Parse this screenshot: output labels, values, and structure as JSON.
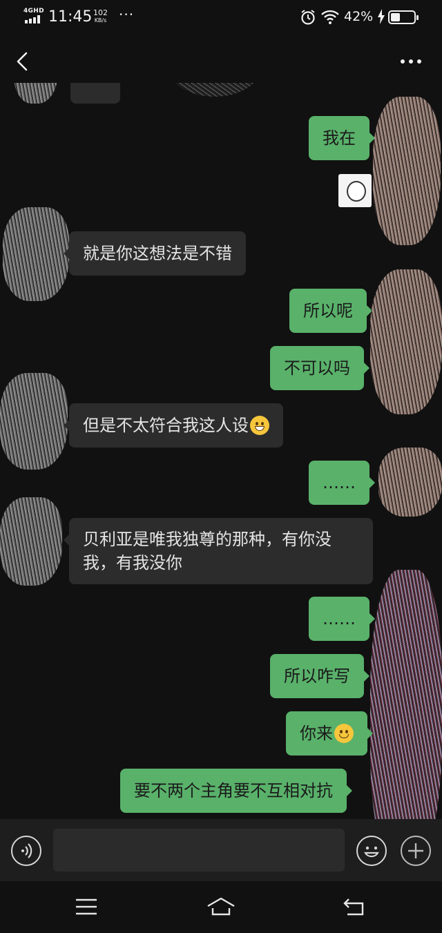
{
  "status_bar": {
    "network": "4GHD",
    "time": "11:45",
    "speed_value": "102",
    "speed_unit": "KB/s",
    "more": "···",
    "battery_percent": "42%",
    "battery_level": 0.42
  },
  "header": {
    "back_icon": "chevron-left-icon",
    "more_icon": "more-horizontal-icon"
  },
  "messages": [
    {
      "side": "out",
      "text": "我在"
    },
    {
      "side": "out",
      "type": "sticker"
    },
    {
      "side": "in",
      "text": "就是你这想法是不错"
    },
    {
      "side": "out",
      "text": "所以呢"
    },
    {
      "side": "out",
      "text": "不可以吗"
    },
    {
      "side": "in",
      "text": "但是不太符合我这人设",
      "emoji": "grin"
    },
    {
      "side": "out",
      "text": "……"
    },
    {
      "side": "in",
      "text_line1": "贝利亚是唯我独尊的那种，有你没",
      "text_line2": "我，有我没你"
    },
    {
      "side": "out",
      "text": "……"
    },
    {
      "side": "out",
      "text": "所以咋写"
    },
    {
      "side": "out",
      "text": "你来",
      "emoji": "smile"
    },
    {
      "side": "out",
      "text": "要不两个主角要不互相对抗"
    }
  ],
  "input_bar": {
    "voice_icon": "voice-icon",
    "input_value": "",
    "emoji_icon": "emoji-icon",
    "plus_icon": "plus-icon"
  },
  "nav_bar": {
    "menu_icon": "menu-icon",
    "home_icon": "home-icon",
    "back_icon": "back-icon"
  },
  "colors": {
    "background": "#111111",
    "bubble_in": "#2c2c2c",
    "bubble_out": "#59b16a"
  }
}
